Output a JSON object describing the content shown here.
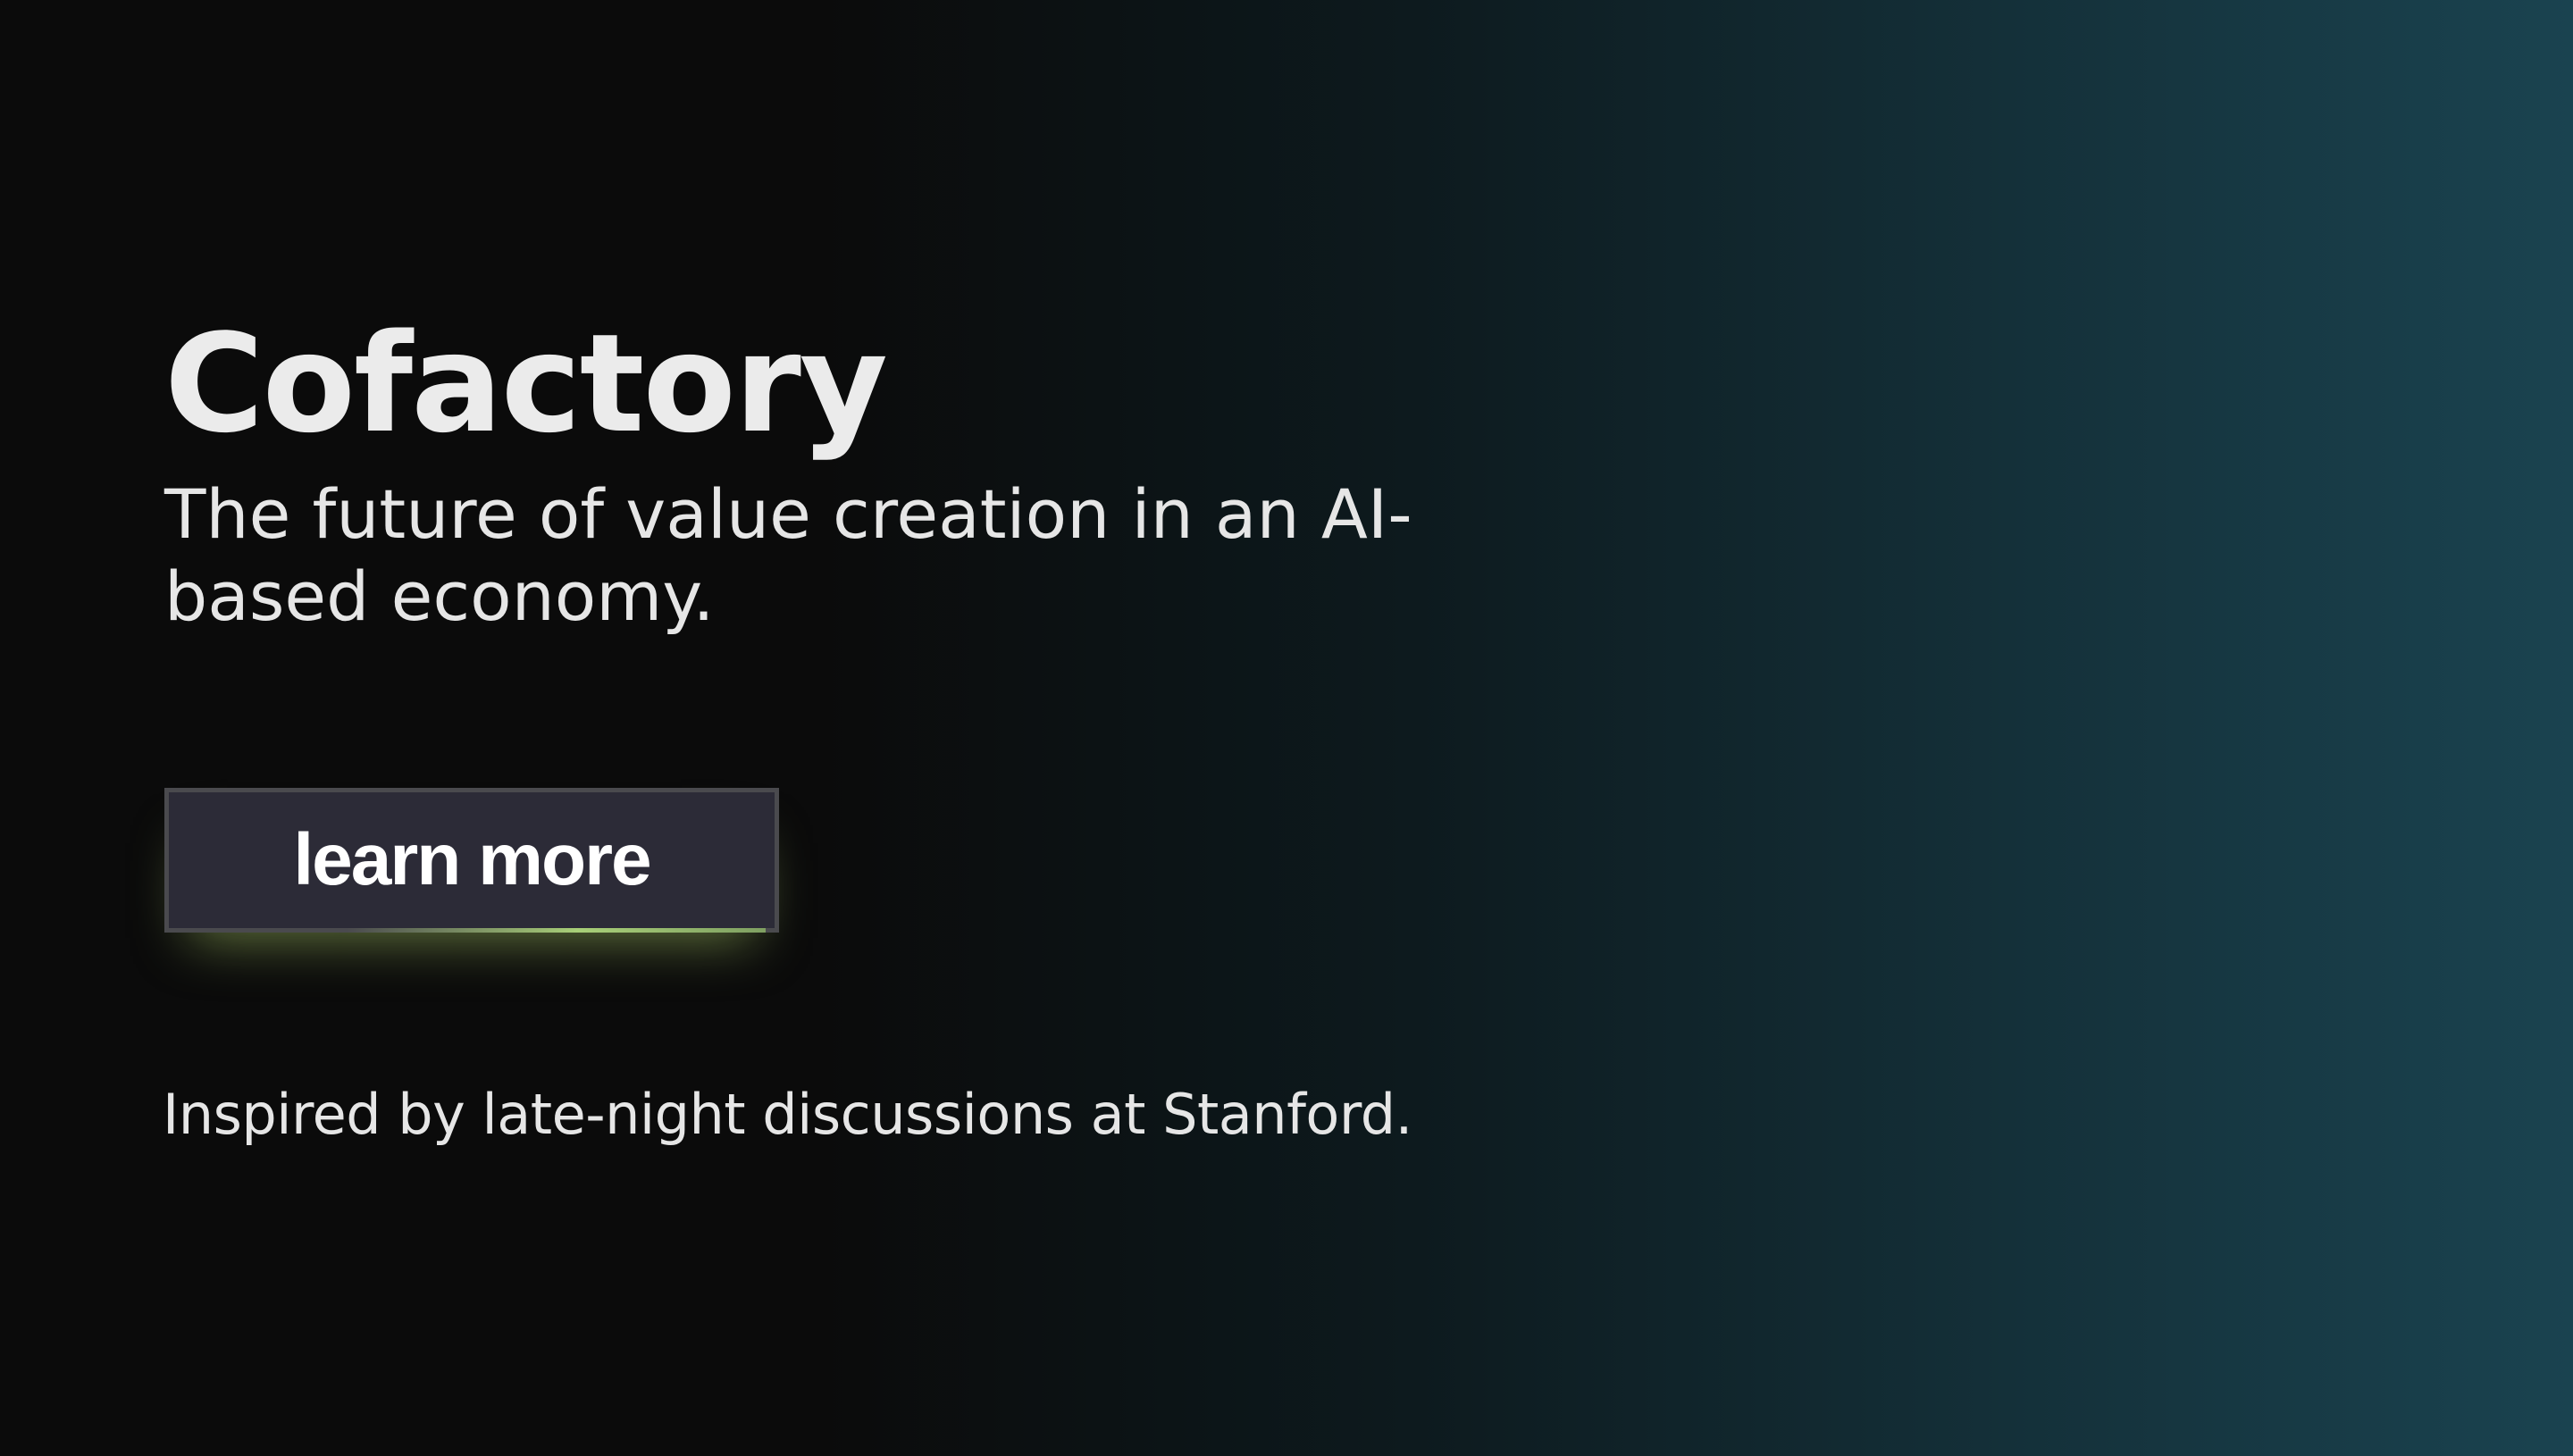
{
  "hero": {
    "title": "Cofactory",
    "tagline": "The future of value creation in an AI-based economy."
  },
  "cta": {
    "label": "learn more"
  },
  "footer": {
    "note": "Inspired by late-night discussions at Stanford."
  },
  "colors": {
    "background_left": "#0b0b0b",
    "background_right": "#1a4350",
    "button_bg": "#2c2b37",
    "button_border": "#4a4a4e",
    "accent_glow": "#a8cf78"
  }
}
